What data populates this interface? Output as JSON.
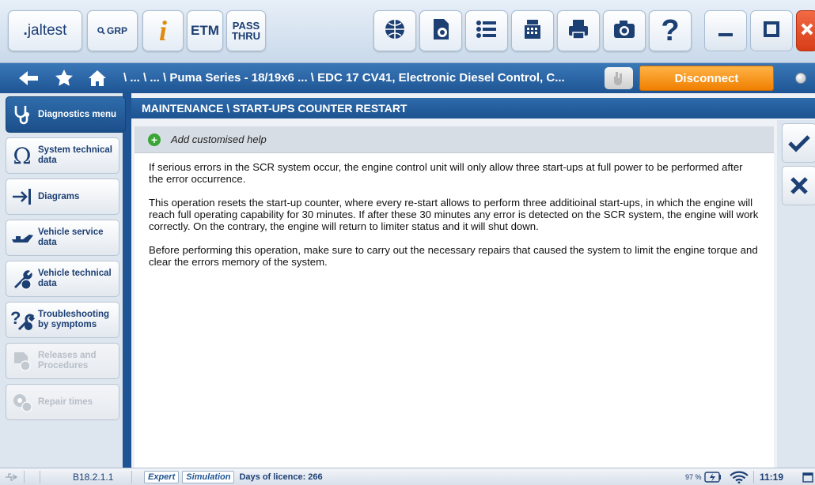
{
  "toolbar": {
    "logo_dot": ".",
    "logo_brand": "jaltest",
    "grp_label": "GRP",
    "info_label": "i",
    "etm_label": "ETM",
    "pass_line1": "PASS",
    "pass_line2": "THRU",
    "help_label": "?"
  },
  "nav": {
    "path": "\\ ... \\ ... \\ Puma Series - 18/19x6 ...  \\ EDC 17 CV41, Electronic Diesel Control, C...",
    "disconnect_label": "Disconnect"
  },
  "sidebar": {
    "items": [
      {
        "label": "Diagnostics menu",
        "icon": "stethoscope-icon",
        "state": "active"
      },
      {
        "label": "System technical data",
        "icon": "omega-icon",
        "state": "normal"
      },
      {
        "label": "Diagrams",
        "icon": "diagram-arrow-icon",
        "state": "normal"
      },
      {
        "label": "Vehicle service data",
        "icon": "oil-can-icon",
        "state": "normal"
      },
      {
        "label": "Vehicle technical data",
        "icon": "wrench-globe-icon",
        "state": "normal"
      },
      {
        "label": "Troubleshooting by symptoms",
        "icon": "question-wrench-icon",
        "state": "normal"
      },
      {
        "label": "Releases and Procedures",
        "icon": "document-globe-icon",
        "state": "disabled"
      },
      {
        "label": "Repair times",
        "icon": "gear-clock-icon",
        "state": "disabled"
      }
    ]
  },
  "main": {
    "title": "MAINTENANCE \\ START-UPS COUNTER RESTART",
    "help_label": "Add customised help",
    "paragraphs": [
      "If serious errors in the SCR system occur, the engine control unit will only allow three start-ups at full power to be performed after the error occurrence.",
      "This operation resets the start-up counter, where every re-start allows to perform three additioinal start-ups, in which the engine will reach full operating capability for 30 minutes. If after these 30 minutes any error is detected on the SCR system, the engine will work correctly. On the contrary, the engine will return to limiter status and it will shut down.",
      "Before performing this operation, make sure to carry out the necessary repairs that caused the system to limit the engine torque and clear the errors memory of the system."
    ]
  },
  "statusbar": {
    "version": "B18.2.1.1",
    "mode_expert": "Expert",
    "mode_simulation": "Simulation",
    "licence_text": "Days of licence: 266",
    "battery": "97 %",
    "time": "11:19"
  },
  "colors": {
    "primary_blue": "#1e5493",
    "accent_orange": "#f07f00",
    "close_red": "#e8502a",
    "help_green": "#3aa635"
  }
}
